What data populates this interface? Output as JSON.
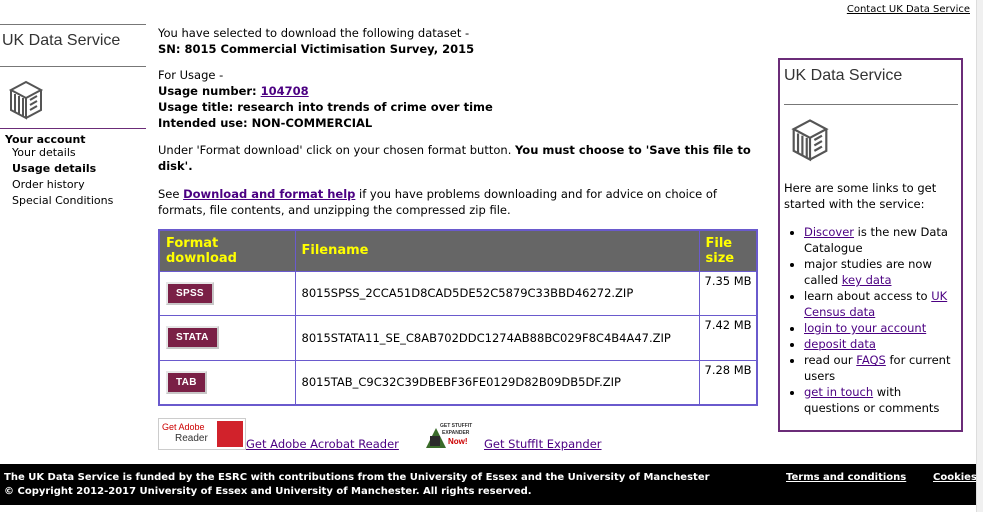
{
  "header": {
    "contact_link": "Contact UK Data Service"
  },
  "left": {
    "logo_text": "UK Data Service",
    "account_heading": "Your account",
    "account_items": [
      "Your details",
      "Usage details",
      "Order history",
      "Special Conditions"
    ]
  },
  "main": {
    "intro_line": "You have selected to download the following dataset -",
    "dataset_line": "SN: 8015 Commercial Victimisation Survey, 2015",
    "for_usage": "For Usage -",
    "usage_number_label": "Usage number:",
    "usage_number": "104708",
    "usage_title": "Usage title: research into trends of crime over time",
    "intended_use": "Intended use: NON-COMMERCIAL",
    "instruction_pre": "Under 'Format download' click on your chosen format button.",
    "instruction_bold": "You must choose to 'Save this file to disk'.",
    "see": "See",
    "help_link": "Download and format help",
    "help_after": "if you have problems downloading and for advice on choice of formats, file contents, and unzipping the compressed zip file.",
    "table": {
      "headers": [
        "Format download",
        "Filename",
        "File size"
      ],
      "rows": [
        {
          "format": "SPSS",
          "filename": "8015SPSS_2CCA51D8CAD5DE52C5879C33BBD46272.ZIP",
          "size": "7.35 MB"
        },
        {
          "format": "STATA",
          "filename": "8015STATA11_SE_C8AB702DDC1274AB88BC029F8C4B4A47.ZIP",
          "size": "7.42 MB"
        },
        {
          "format": "TAB",
          "filename": "8015TAB_C9C32C39DBEBF36FE0129D82B09DB5DF.ZIP",
          "size": "7.28 MB"
        }
      ]
    },
    "adobe_badge_line1": "Get Adobe",
    "adobe_badge_line2": "Reader",
    "adobe_link": "Get Adobe Acrobat Reader",
    "stuffit_badge_line1": "GET STUFFIT",
    "stuffit_badge_line2": "EXPANDER",
    "stuffit_badge_line3": "Now!",
    "stuffit_link": "Get StuffIt Expander"
  },
  "right": {
    "logo_text": "UK Data Service",
    "intro": "Here are some links to get started with the service:",
    "items": {
      "discover_link": "Discover",
      "discover_rest": "is the new Data Catalogue",
      "studies_pre": "major studies are now called",
      "key_data_link": "key data",
      "census_pre": "learn about access to",
      "census_link": "UK Census data",
      "login_link": "login to your account",
      "deposit_link": "deposit data",
      "faqs_pre": "read our",
      "faqs_link": "FAQS",
      "faqs_post": "for current users",
      "touch_link": "get in touch",
      "touch_post": "with questions or comments"
    }
  },
  "footer": {
    "line1": "The UK Data Service is funded by the ESRC with contributions from the University of Essex and the University of Manchester",
    "line2": "© Copyright 2012-2017 University of Essex and University of Manchester. All rights reserved.",
    "terms_link": "Terms and conditions",
    "cookies_link": "Cookies"
  },
  "colors": {
    "table_header_bg": "#666666",
    "table_header_text": "#ffff00",
    "table_border": "#6a5acd",
    "format_button_bg": "#7a2046",
    "right_box_border": "#6b2c78",
    "link": "#4b0082"
  }
}
